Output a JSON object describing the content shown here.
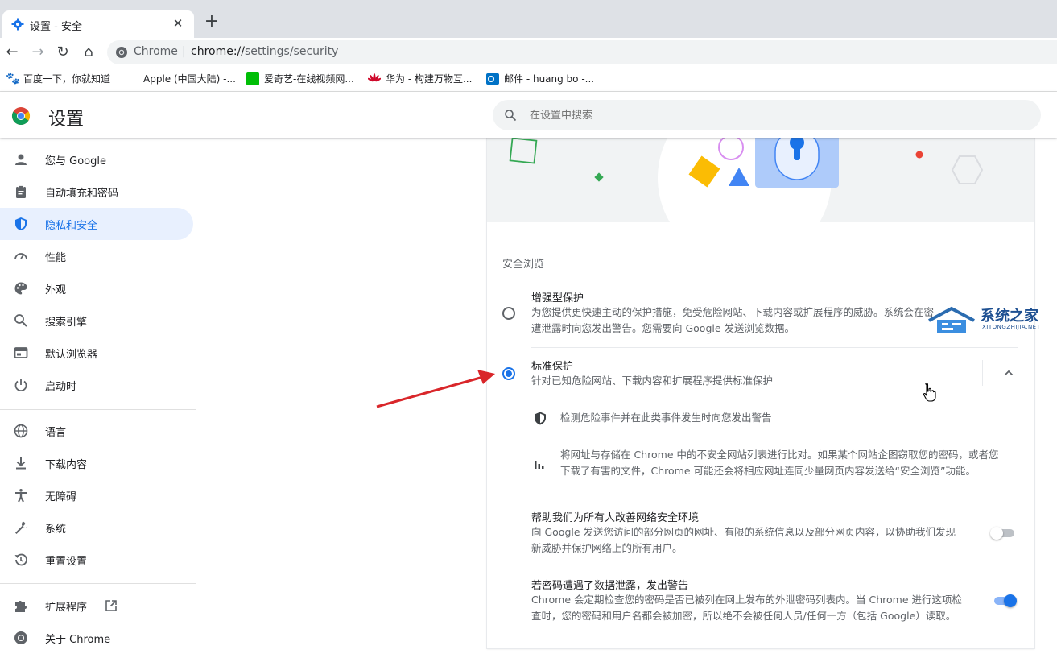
{
  "tab": {
    "title": "设置 - 安全",
    "close": "✕",
    "new_tab": "+"
  },
  "toolbar": {
    "back": "←",
    "forward": "→",
    "reload": "↻",
    "home": "⌂",
    "site_label": "Chrome",
    "url_scheme": "chrome://",
    "url_path": "settings/security"
  },
  "bookmarks": [
    {
      "label": "百度一下，你就知道",
      "icon": "baidu-icon",
      "color": "#2932e1"
    },
    {
      "label": "Apple (中国大陆) -...",
      "icon": "apple-icon",
      "color": "#555555"
    },
    {
      "label": "爱奇艺-在线视频网...",
      "icon": "iqiyi-icon",
      "color": "#00be06"
    },
    {
      "label": "华为 - 构建万物互...",
      "icon": "huawei-icon",
      "color": "#cf0a2c"
    },
    {
      "label": "邮件 - huang bo -...",
      "icon": "outlook-icon",
      "color": "#0072c6"
    }
  ],
  "header": {
    "title": "设置",
    "search_placeholder": "在设置中搜索"
  },
  "sidebar": {
    "items": [
      {
        "label": "您与 Google",
        "icon": "person-icon"
      },
      {
        "label": "自动填充和密码",
        "icon": "clipboard-icon"
      },
      {
        "label": "隐私和安全",
        "icon": "shield-icon",
        "active": true
      },
      {
        "label": "性能",
        "icon": "speedometer-icon"
      },
      {
        "label": "外观",
        "icon": "palette-icon"
      },
      {
        "label": "搜索引擎",
        "icon": "search-icon"
      },
      {
        "label": "默认浏览器",
        "icon": "browser-icon"
      },
      {
        "label": "启动时",
        "icon": "power-icon"
      },
      {
        "label": "语言",
        "icon": "globe-icon"
      },
      {
        "label": "下载内容",
        "icon": "download-icon"
      },
      {
        "label": "无障碍",
        "icon": "accessibility-icon"
      },
      {
        "label": "系统",
        "icon": "wrench-icon"
      },
      {
        "label": "重置设置",
        "icon": "history-icon"
      },
      {
        "label": "扩展程序",
        "icon": "puzzle-icon"
      },
      {
        "label": "关于 Chrome",
        "icon": "chrome-icon"
      }
    ]
  },
  "main": {
    "section_title": "安全浏览",
    "enhanced": {
      "title": "增强型保护",
      "desc1": "为您提供更快速主动的保护措施，免受危险网站、下载内容或扩展程序的威胁。系统会在密",
      "desc2": "遭泄露时向您发出警告。您需要向 Google 发送浏览数据。",
      "checked": false
    },
    "standard": {
      "title": "标准保护",
      "desc": "针对已知危险网站、下载内容和扩展程序提供标准保护",
      "checked": true,
      "expand": "⌃"
    },
    "details": [
      {
        "icon": "shield-icon",
        "text": "检测危险事件并在此类事件发生时向您发出警告"
      },
      {
        "icon": "bar-chart-icon",
        "line1": "将网址与存储在 Chrome 中的不安全网站列表进行比对。如果某个网站企图窃取您的密码，或者您",
        "line2": "下载了有害的文件，Chrome 可能还会将相应网址连同少量网页内容发送给“安全浏览”功能。"
      }
    ],
    "help_improve": {
      "title": "帮助我们为所有人改善网络安全环境",
      "desc1": "向 Google 发送您访问的部分网页的网址、有限的系统信息以及部分网页内容，以协助我们发现",
      "desc2": "新威胁并保护网络上的所有用户。",
      "enabled": false
    },
    "password_warn": {
      "title": "若密码遭遇了数据泄露，发出警告",
      "desc1": "Chrome 会定期检查您的密码是否已被列在网上发布的外泄密码列表内。当 Chrome 进行这项检",
      "desc2": "查时，您的密码和用户名都会被加密，所以绝不会被任何人员/任何一方（包括 Google）读取。",
      "enabled": true
    }
  },
  "watermark": {
    "title": "系统之家",
    "sub": "XITONGZHIJIA.NET"
  },
  "colors": {
    "accent": "#1a73e8",
    "text": "#202124",
    "secondary": "#5f6368",
    "arrow": "#d9262a"
  }
}
